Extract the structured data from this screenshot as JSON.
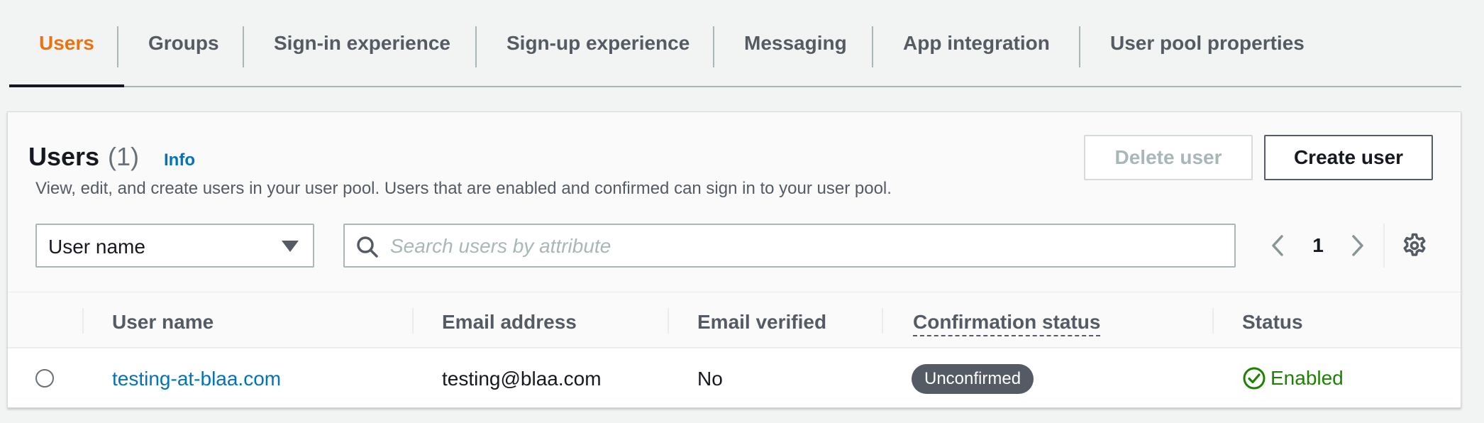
{
  "tabs": [
    {
      "label": "Users",
      "active": true
    },
    {
      "label": "Groups",
      "active": false
    },
    {
      "label": "Sign-in experience",
      "active": false
    },
    {
      "label": "Sign-up experience",
      "active": false
    },
    {
      "label": "Messaging",
      "active": false
    },
    {
      "label": "App integration",
      "active": false
    },
    {
      "label": "User pool properties",
      "active": false
    }
  ],
  "panel": {
    "title": "Users",
    "count": "(1)",
    "info_label": "Info",
    "description": "View, edit, and create users in your user pool. Users that are enabled and confirmed can sign in to your user pool.",
    "delete_button_label": "Delete user",
    "create_button_label": "Create user"
  },
  "filter": {
    "attribute_selected": "User name",
    "search_placeholder": "Search users by attribute",
    "search_value": ""
  },
  "pagination": {
    "current_page": "1"
  },
  "table": {
    "columns": [
      "User name",
      "Email address",
      "Email verified",
      "Confirmation status",
      "Status"
    ],
    "rows": [
      {
        "user_name": "testing-at-blaa.com",
        "email": "testing@blaa.com",
        "email_verified": "No",
        "confirmation_status": "Unconfirmed",
        "status": "Enabled"
      }
    ]
  },
  "icons": {
    "search": "search-icon",
    "settings": "gear-icon",
    "prev": "chevron-left-icon",
    "next": "chevron-right-icon",
    "caret": "caret-down-icon",
    "status": "check-circle-icon"
  },
  "colors": {
    "accent": "#ec7211",
    "link": "#0073bb",
    "success": "#1d8102",
    "badge": "#545b64"
  }
}
